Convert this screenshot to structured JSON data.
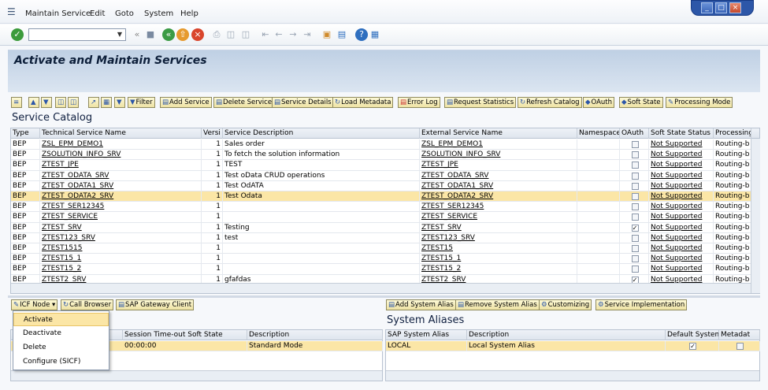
{
  "menu": [
    "Maintain Service",
    "Edit",
    "Goto",
    "System",
    "Help"
  ],
  "window_controls": [
    "_",
    "□",
    "×"
  ],
  "title": "Activate and Maintain Services",
  "app_toolbar": [
    {
      "label": "Filter",
      "icon": "filter-icon"
    },
    {
      "label": "Add Service",
      "icon": "add-icon"
    },
    {
      "label": "Delete Service",
      "icon": "delete-icon"
    },
    {
      "label": "Service Details",
      "icon": "details-icon"
    },
    {
      "label": "Load Metadata",
      "icon": "load-icon"
    },
    {
      "label": "Error Log",
      "icon": "error-log-icon"
    },
    {
      "label": "Request Statistics",
      "icon": "statistics-icon"
    },
    {
      "label": "Refresh Catalog",
      "icon": "refresh-icon"
    },
    {
      "label": "OAuth",
      "icon": "oauth-icon"
    },
    {
      "label": "Soft State",
      "icon": "soft-state-icon"
    },
    {
      "label": "Processing Mode",
      "icon": "processing-icon"
    }
  ],
  "catalog": {
    "title": "Service Catalog",
    "columns": [
      "Type",
      "Technical Service Name",
      "Versi",
      "Service Description",
      "External Service Name",
      "Namespace",
      "OAuth",
      "Soft State Status",
      "Processing"
    ],
    "rows": [
      {
        "type": "BEP",
        "tech": "ZSL_EPM_DEMO1",
        "ver": "1",
        "desc": "Sales order",
        "ext": "ZSL_EPM_DEMO1",
        "oauth": false,
        "soft": "Not Supported",
        "proc": "Routing-b"
      },
      {
        "type": "BEP",
        "tech": "ZSOLUTION_INFO_SRV",
        "ver": "1",
        "desc": "To fetch the solution information",
        "ext": "ZSOLUTION_INFO_SRV",
        "oauth": false,
        "soft": "Not Supported",
        "proc": "Routing-b"
      },
      {
        "type": "BEP",
        "tech": "ZTEST_JPE",
        "ver": "1",
        "desc": "TEST",
        "ext": "ZTEST_JPE",
        "oauth": false,
        "soft": "Not Supported",
        "proc": "Routing-b"
      },
      {
        "type": "BEP",
        "tech": "ZTEST_ODATA_SRV",
        "ver": "1",
        "desc": "Test oData CRUD operations",
        "ext": "ZTEST_ODATA_SRV",
        "oauth": false,
        "soft": "Not Supported",
        "proc": "Routing-b"
      },
      {
        "type": "BEP",
        "tech": "ZTEST_ODATA1_SRV",
        "ver": "1",
        "desc": "Test OdATA",
        "ext": "ZTEST_ODATA1_SRV",
        "oauth": false,
        "soft": "Not Supported",
        "proc": "Routing-b"
      },
      {
        "type": "BEP",
        "tech": "ZTEST_ODATA2_SRV",
        "ver": "1",
        "desc": "Test Odata",
        "ext": "ZTEST_ODATA2_SRV",
        "oauth": false,
        "soft": "Not Supported",
        "proc": "Routing-b",
        "selected": true
      },
      {
        "type": "BEP",
        "tech": "ZTEST_SER12345",
        "ver": "1",
        "desc": "",
        "ext": "ZTEST_SER12345",
        "oauth": false,
        "soft": "Not Supported",
        "proc": "Routing-b"
      },
      {
        "type": "BEP",
        "tech": "ZTEST_SERVICE",
        "ver": "1",
        "desc": "",
        "ext": "ZTEST_SERVICE",
        "oauth": false,
        "soft": "Not Supported",
        "proc": "Routing-b"
      },
      {
        "type": "BEP",
        "tech": "ZTEST_SRV",
        "ver": "1",
        "desc": "Testing",
        "ext": "ZTEST_SRV",
        "oauth": true,
        "soft": "Not Supported",
        "proc": "Routing-b"
      },
      {
        "type": "BEP",
        "tech": "ZTEST123_SRV",
        "ver": "1",
        "desc": "test",
        "ext": "ZTEST123_SRV",
        "oauth": false,
        "soft": "Not Supported",
        "proc": "Routing-b"
      },
      {
        "type": "BEP",
        "tech": "ZTEST1515",
        "ver": "1",
        "desc": "",
        "ext": "ZTEST15",
        "oauth": false,
        "soft": "Not Supported",
        "proc": "Routing-b"
      },
      {
        "type": "BEP",
        "tech": "ZTEST15_1",
        "ver": "1",
        "desc": "",
        "ext": "ZTEST15_1",
        "oauth": false,
        "soft": "Not Supported",
        "proc": "Routing-b"
      },
      {
        "type": "BEP",
        "tech": "ZTEST15_2",
        "ver": "1",
        "desc": "",
        "ext": "ZTEST15_2",
        "oauth": false,
        "soft": "Not Supported",
        "proc": "Routing-b"
      },
      {
        "type": "BEP",
        "tech": "ZTEST2_SRV",
        "ver": "1",
        "desc": "gfafdas",
        "ext": "ZTEST2_SRV",
        "oauth": true,
        "soft": "Not Supported",
        "proc": "Routing-b"
      }
    ]
  },
  "icf": {
    "toolbar": [
      "ICF Node",
      "Call Browser",
      "SAP Gateway Client"
    ],
    "menu": [
      "Activate",
      "Deactivate",
      "Delete",
      "Configure (SICF)"
    ],
    "columns": [
      "Session Time-out Soft State",
      "Description"
    ],
    "rows": [
      {
        "timeout": "00:00:00",
        "desc": "Standard Mode"
      }
    ]
  },
  "aliases": {
    "title": "System Aliases",
    "toolbar": [
      "Add System Alias",
      "Remove System Alias",
      "Customizing",
      "Service Implementation"
    ],
    "columns": [
      "SAP System Alias",
      "Description",
      "Default System",
      "Metadat"
    ],
    "rows": [
      {
        "alias": "LOCAL",
        "desc": "Local System Alias",
        "default": true,
        "meta": false
      }
    ]
  },
  "colors": {
    "selected_row": "#fbe6a6",
    "title_band": "#c9d8ea",
    "button": "#f5eebf"
  }
}
